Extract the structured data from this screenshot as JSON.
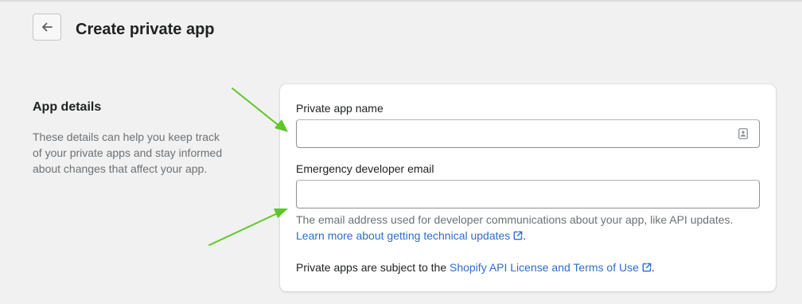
{
  "header": {
    "back_icon": "arrow-left-icon",
    "title": "Create private app"
  },
  "app_details": {
    "title": "App details",
    "description": "These details can help you keep track of your private apps and stay informed about changes that affect your app."
  },
  "form": {
    "app_name": {
      "label": "Private app name",
      "value": "",
      "placeholder": "",
      "icon": "contact-card-icon"
    },
    "email": {
      "label": "Emergency developer email",
      "value": "",
      "placeholder": "",
      "help_text": "The email address used for developer communications about your app, like API updates.",
      "link_text": "Learn more about getting technical updates",
      "link_suffix": "."
    },
    "terms": {
      "prefix": "Private apps are subject to the ",
      "link_text": "Shopify API License and Terms of Use",
      "suffix": "."
    }
  },
  "colors": {
    "background": "#f1f1f1",
    "card": "#ffffff",
    "link": "#2c6ecb",
    "annotation_arrow": "#5fc62a"
  }
}
